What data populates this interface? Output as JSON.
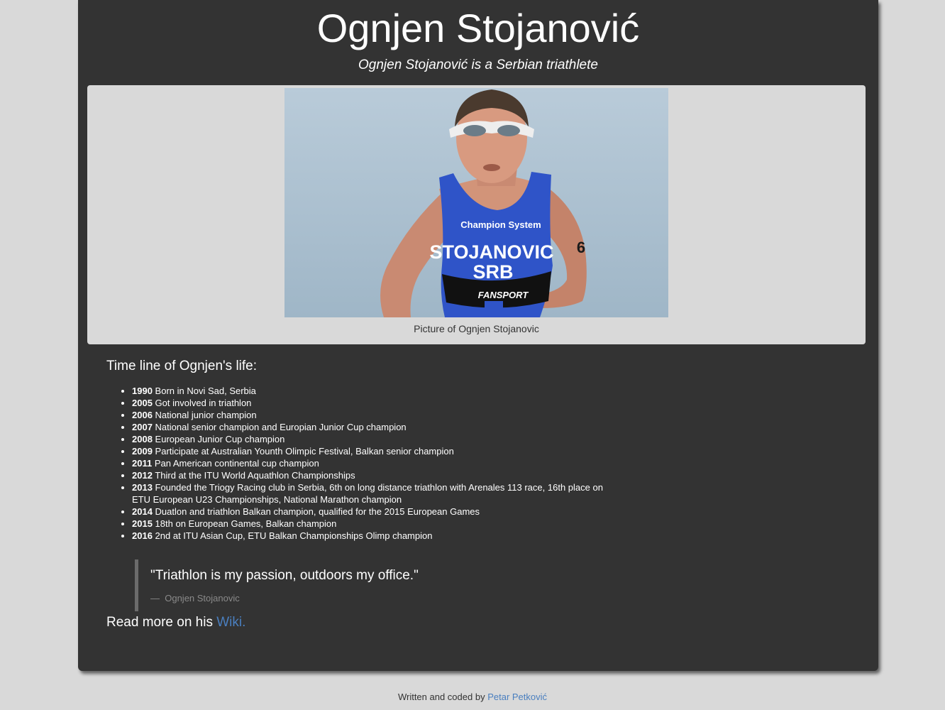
{
  "header": {
    "title": "Ognjen Stojanović",
    "tagline": "Ognjen Stojanović is a Serbian triathlete"
  },
  "image": {
    "caption": "Picture of Ognjen Stojanovic",
    "jersey_brand": "Champion System",
    "jersey_name": "STOJANOVIC",
    "jersey_country": "SRB",
    "jersey_sponsor": "FANSPORT",
    "arm_number": "6"
  },
  "timeline": {
    "heading": "Time line of Ognjen's life:",
    "items": [
      {
        "year": "1990",
        "text": "Born in Novi Sad, Serbia"
      },
      {
        "year": "2005",
        "text": "Got involved in triathlon"
      },
      {
        "year": "2006",
        "text": "National junior champion"
      },
      {
        "year": "2007",
        "text": "National senior champion and Europian Junior Cup champion"
      },
      {
        "year": "2008",
        "text": "European Junior Cup champion"
      },
      {
        "year": "2009",
        "text": "Participate at Australian Younth Olimpic Festival, Balkan senior champion"
      },
      {
        "year": "2011",
        "text": "Pan American continental cup champion"
      },
      {
        "year": "2012",
        "text": "Third at the ITU World Aquathlon Championships"
      },
      {
        "year": "2013",
        "text": "Founded the Triogy Racing club in Serbia, 6th on long distance triathlon with Arenales 113 race, 16th place on ETU European U23 Championships, National Marathon champion"
      },
      {
        "year": "2014",
        "text": "Duatlon and triathlon Balkan champion, qualified for the 2015 European Games"
      },
      {
        "year": "2015",
        "text": "18th on European Games, Balkan champion"
      },
      {
        "year": "2016",
        "text": "2nd at ITU Asian Cup, ETU Balkan Championships Olimp champion"
      }
    ]
  },
  "quote": {
    "text": "\"Triathlon is my passion, outdoors my office.\"",
    "dash": "—",
    "author": "Ognjen Stojanovic"
  },
  "read_more": {
    "prefix": "Read more on his",
    "link_label": "Wiki."
  },
  "footer": {
    "prefix": "Written and coded by",
    "author_link": "Petar Petković"
  },
  "colors": {
    "page_background": "#d9d9d9",
    "container_background": "#333333",
    "link": "#4a7fbf",
    "jersey_blue": "#2f54c8"
  }
}
